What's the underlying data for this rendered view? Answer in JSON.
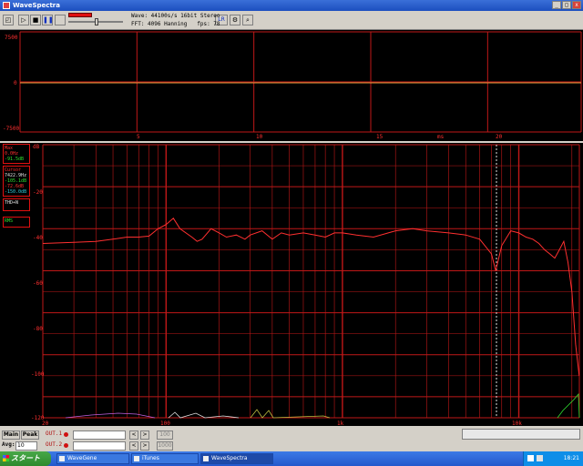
{
  "window": {
    "title": "WaveSpectra"
  },
  "toolbar": {
    "wave_info": "Wave: 44100s/s 16bit Stereo",
    "fft_info": "FFT: 4096 Hanning   fps: 78",
    "lr_label": "LR"
  },
  "time_plot": {
    "y_ticks": [
      "7500",
      "0",
      "-7500"
    ],
    "x_ticks": [
      "5",
      "10",
      "15",
      "20"
    ],
    "x_unit": "ms"
  },
  "freq_plot": {
    "y_unit": "dB",
    "y_ticks": [
      "-20",
      "-40",
      "-60",
      "-80",
      "-100",
      "-120"
    ],
    "x_ticks": [
      "20",
      "100",
      "1k",
      "10k"
    ]
  },
  "side_panel": {
    "max_label": "Max",
    "max_freq": "0.0Hz",
    "max_level": "-91.5dB",
    "cursor_label": "Cursor",
    "cursor_freq": "7422.9Hz",
    "cursor_l": "-105.1dB",
    "cursor_r": "-72.6dB",
    "cursor_diff": "-150.0dB",
    "thd_label": "THD+N",
    "rms_label": "RMS"
  },
  "bottom": {
    "main_label": "Main",
    "peak_label": "Peak",
    "avg_label": "Avg:",
    "avg_value": "10",
    "out1_label": "OUT.1",
    "out2_label": "OUT.2",
    "btn_100": "100",
    "btn_1000": "1000"
  },
  "taskbar": {
    "start_label": "スタート",
    "tasks": [
      "WaveGene",
      "iTunes",
      "WaveSpectra"
    ],
    "clock": "18:21"
  },
  "colors": {
    "grid": "#c01818",
    "trace_time": "#e0a040",
    "trace_spectrum": "#ff3030",
    "noise_floor": "#30e030"
  },
  "chart_data": [
    {
      "type": "line",
      "title": "",
      "xlabel": "ms",
      "ylabel": "",
      "xlim": [
        0,
        24
      ],
      "ylim": [
        -7500,
        7500
      ],
      "series": [
        {
          "x": [
            0,
            24
          ],
          "values": [
            0,
            0
          ]
        }
      ]
    },
    {
      "type": "line",
      "title": "",
      "xlabel": "",
      "ylabel": "dB",
      "x_scale": "log",
      "xlim": [
        20,
        22050
      ],
      "ylim": [
        -130,
        0
      ],
      "series": [
        {
          "x": [
            20,
            30,
            40,
            50,
            60,
            70,
            80,
            90,
            100,
            110,
            120,
            140,
            150,
            160,
            180,
            200,
            220,
            250,
            280,
            300,
            350,
            400,
            450,
            500,
            600,
            700,
            800,
            900,
            1000,
            1200,
            1500,
            2000,
            2500,
            3000,
            4000,
            5000,
            6000,
            7000,
            7400,
            7800,
            8000,
            9000,
            10000,
            11000,
            12000,
            13000,
            14000,
            15000,
            16000,
            17000,
            18000,
            19000,
            20000,
            21000,
            22000
          ],
          "values": [
            -47,
            -46.5,
            -46,
            -45,
            -44,
            -44,
            -43.5,
            -40,
            -38,
            -35,
            -40,
            -44,
            -46,
            -45,
            -40,
            -42,
            -44,
            -43,
            -45,
            -43,
            -41,
            -45,
            -42,
            -43,
            -42,
            -43,
            -44,
            -42,
            -42,
            -43,
            -44,
            -41,
            -40,
            -41,
            -42,
            -43,
            -45,
            -52,
            -60,
            -52,
            -48,
            -41,
            -42,
            -44,
            -45,
            -47,
            -50,
            -52,
            -54,
            -50,
            -46,
            -56,
            -70,
            -95,
            -110
          ]
        }
      ]
    }
  ]
}
